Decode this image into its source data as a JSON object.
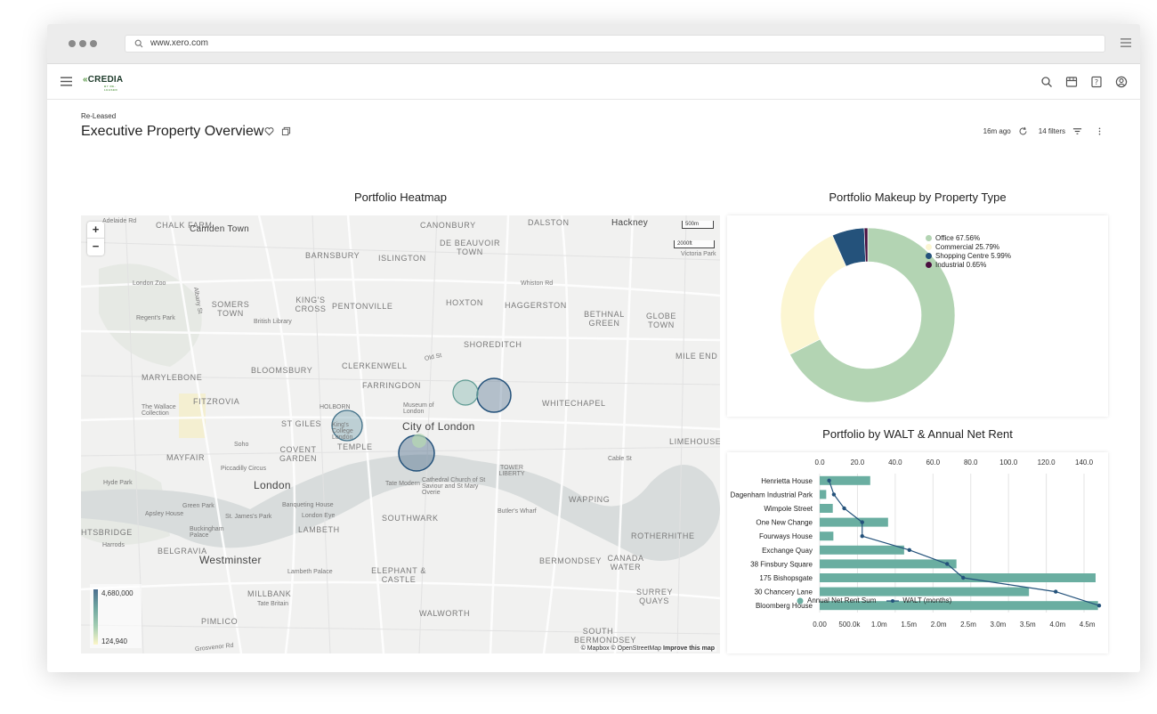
{
  "browser": {
    "url": "www.xero.com"
  },
  "app": {
    "logo": "CREDIA",
    "logo_sub": "BY RE-LEASED"
  },
  "page": {
    "breadcrumb": "Re-Leased",
    "title": "Executive Property Overview",
    "last_updated": "16m ago",
    "filters": "14 filters"
  },
  "heatmap": {
    "title": "Portfolio Heatmap",
    "labels": [
      "Adelaide Rd",
      "CHALK FARM",
      "Camden Town",
      "CANONBURY",
      "DALSTON",
      "Hackney",
      "DE BEAUVOIR TOWN",
      "BARNSBURY",
      "ISLINGTON",
      "London Zoo",
      "SOMERS TOWN",
      "KING'S CROSS",
      "PENTONVILLE",
      "HOXTON",
      "HAGGERSTON",
      "Whiston Rd",
      "BETHNAL GREEN",
      "GLOBE TOWN",
      "Albany St",
      "Regent's Park",
      "British Library",
      "SHOREDITCH",
      "Old St",
      "MILE END",
      "MARYLEBONE",
      "BLOOMSBURY",
      "CLERKENWELL",
      "FARRINGDON",
      "The Wallace Collection",
      "FITZROVIA",
      "Museum of London",
      "WHITECHAPEL",
      "HOLBORN",
      "ST GILES",
      "King's College London",
      "City of London",
      "Soho",
      "TEMPLE",
      "COVENT GARDEN",
      "MAYFAIR",
      "Piccadilly Circus",
      "Cable St",
      "LIMEHOUSE",
      "TOWER LIBERTY",
      "Hyde Park",
      "London",
      "Tate Modern",
      "Cathedral Church of St Saviour and St Mary Overie",
      "WAPPING",
      "Green Park",
      "Banqueting House",
      "Apsley House",
      "St. James's Park",
      "London Eye",
      "Buckingham Palace",
      "LAMBETH",
      "SOUTHWARK",
      "Butler's Wharf",
      "ROTHERHITHE",
      "Harrods",
      "BELGRAVIA",
      "HTSBRIDGE",
      "Westminster",
      "Lambeth Palace",
      "ELEPHANT & CASTLE",
      "BERMONDSEY",
      "CANADA WATER",
      "SURREY QUAYS",
      "MILLBANK",
      "Tate Britain",
      "PIMLICO",
      "WALWORTH",
      "SOUTH BERMONDSEY",
      "Grosvenor Rd",
      "Victoria Park"
    ],
    "scale": [
      "500m",
      "2000ft"
    ],
    "legend_max": "4,680,000",
    "legend_min": "124,940",
    "attribution_a": "© Mapbox © OpenStreetMap",
    "attribution_b": "Improve this map",
    "zoom_in": "+",
    "zoom_out": "−",
    "bubble_colors": [
      "#3f6183",
      "#7eb3aa",
      "#5d8fa0",
      "#6ea7a5"
    ]
  },
  "donut": {
    "title": "Portfolio Makeup by Property Type",
    "items": [
      {
        "label": "Office 67.56%",
        "value": 67.56,
        "color": "#b3d4b3"
      },
      {
        "label": "Commercial 25.79%",
        "value": 25.79,
        "color": "#fcf6d2"
      },
      {
        "label": "Shopping Centre 5.99%",
        "value": 5.99,
        "color": "#24527b"
      },
      {
        "label": "Industrial 0.65%",
        "value": 0.65,
        "color": "#4a0f3f"
      }
    ]
  },
  "chart_data": {
    "type": "bar",
    "title": "Portfolio by WALT & Annual Net Rent",
    "categories": [
      "Henrietta House",
      "Dagenham Industrial Park",
      "Wimpole Street",
      "One New Change",
      "Fourways House",
      "Exchange Quay",
      "38 Finsbury Square",
      "175 Bishopsgate",
      "30 Chancery Lane",
      "Bloomberg House"
    ],
    "series": [
      {
        "name": "Annual Net Rent Sum",
        "type": "bar",
        "axis": "bottom",
        "color": "#6aaea1",
        "values": [
          850000,
          110000,
          220000,
          1150000,
          230000,
          1420000,
          2300000,
          4640000,
          3520000,
          4680000
        ]
      },
      {
        "name": "WALT (months)",
        "type": "line",
        "axis": "top",
        "color": "#24527b",
        "values": [
          5,
          7.5,
          13,
          22.5,
          22.5,
          47.5,
          67.5,
          76,
          125,
          148
        ]
      }
    ],
    "x_bottom": {
      "ticks": [
        "0.00",
        "500.0k",
        "1.0m",
        "1.5m",
        "2.0m",
        "2.5m",
        "3.0m",
        "3.5m",
        "4.0m",
        "4.5m"
      ],
      "lim": [
        0,
        4700000
      ]
    },
    "x_top": {
      "ticks": [
        "0.0",
        "20.0",
        "40.0",
        "60.0",
        "80.0",
        "100.0",
        "120.0",
        "140.0"
      ],
      "lim": [
        0,
        148
      ]
    },
    "grid": true,
    "legend": "bottom"
  }
}
